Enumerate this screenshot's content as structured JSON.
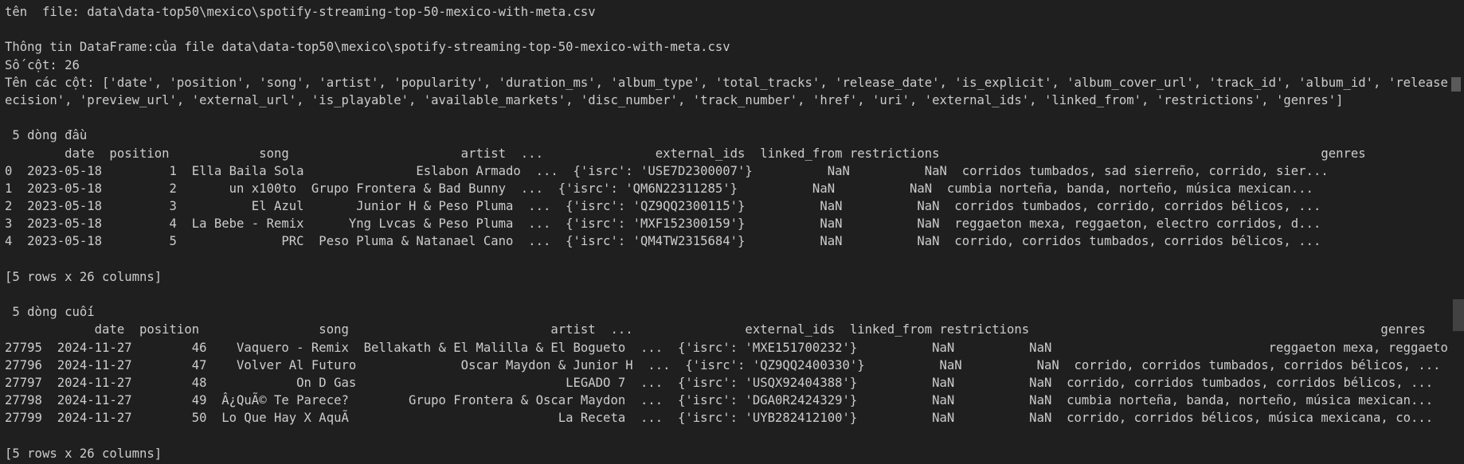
{
  "terminal": {
    "lines": [
      "tên  file: data\\data-top50\\mexico\\spotify-streaming-top-50-mexico-with-meta.csv",
      "",
      "Thông tin DataFrame:của file data\\data-top50\\mexico\\spotify-streaming-top-50-mexico-with-meta.csv",
      "Số cột: 26",
      "Tên các cột: ['date', 'position', 'song', 'artist', 'popularity', 'duration_ms', 'album_type', 'total_tracks', 'release_date', 'is_explicit', 'album_cover_url', 'track_id', 'album_id', 'release_date_pr",
      "ecision', 'preview_url', 'external_url', 'is_playable', 'available_markets', 'disc_number', 'track_number', 'href', 'uri', 'external_ids', 'linked_from', 'restrictions', 'genres']",
      "",
      " 5 dòng đầu",
      "        date  position            song                       artist  ...               external_ids  linked_from restrictions                                                   genres",
      "0  2023-05-18         1  Ella Baila Sola               Eslabon Armado  ...  {'isrc': 'USE7D2300007'}          NaN          NaN  corridos tumbados, sad sierreño, corrido, sier...",
      "1  2023-05-18         2       un x100to  Grupo Frontera & Bad Bunny  ...  {'isrc': 'QM6N22311285'}          NaN          NaN  cumbia norteña, banda, norteño, música mexican...",
      "2  2023-05-18         3          El Azul       Junior H & Peso Pluma  ...  {'isrc': 'QZ9QQ2300115'}          NaN          NaN  corridos tumbados, corrido, corridos bélicos, ...",
      "3  2023-05-18         4  La Bebe - Remix      Yng Lvcas & Peso Pluma  ...  {'isrc': 'MXF152300159'}          NaN          NaN  reggaeton mexa, reggaeton, electro corridos, d...",
      "4  2023-05-18         5              PRC  Peso Pluma & Natanael Cano  ...  {'isrc': 'QM4TW2315684'}          NaN          NaN  corrido, corridos tumbados, corridos bélicos, ...",
      "",
      "[5 rows x 26 columns]",
      "",
      " 5 dòng cuối",
      "            date  position                song                           artist  ...               external_ids  linked_from restrictions                                               genres",
      "27795  2024-11-27        46    Vaquero - Remix  Bellakath & El Malilla & El Bogueto  ...  {'isrc': 'MXE151700232'}          NaN          NaN                             reggaeton mexa, reggaeton",
      "27796  2024-11-27        47    Volver Al Futuro              Oscar Maydon & Junior H  ...  {'isrc': 'QZ9QQ2400330'}          NaN          NaN  corrido, corridos tumbados, corridos bélicos, ...",
      "27797  2024-11-27        48            On D Gas                            LEGADO 7  ...  {'isrc': 'USQX92404388'}          NaN          NaN  corrido, corridos tumbados, corridos bélicos, ...",
      "27798  2024-11-27        49  Â¿QuÃ© Te Parece?        Grupo Frontera & Oscar Maydon  ...  {'isrc': 'DGA0R2424329'}          NaN          NaN  cumbia norteña, banda, norteño, música mexican...",
      "27799  2024-11-27        50  Lo Que Hay X AquÃ                            La Receta  ...  {'isrc': 'UYB282412100'}          NaN          NaN  corrido, corridos bélicos, música mexicana, co...",
      "",
      "[5 rows x 26 columns]"
    ]
  }
}
